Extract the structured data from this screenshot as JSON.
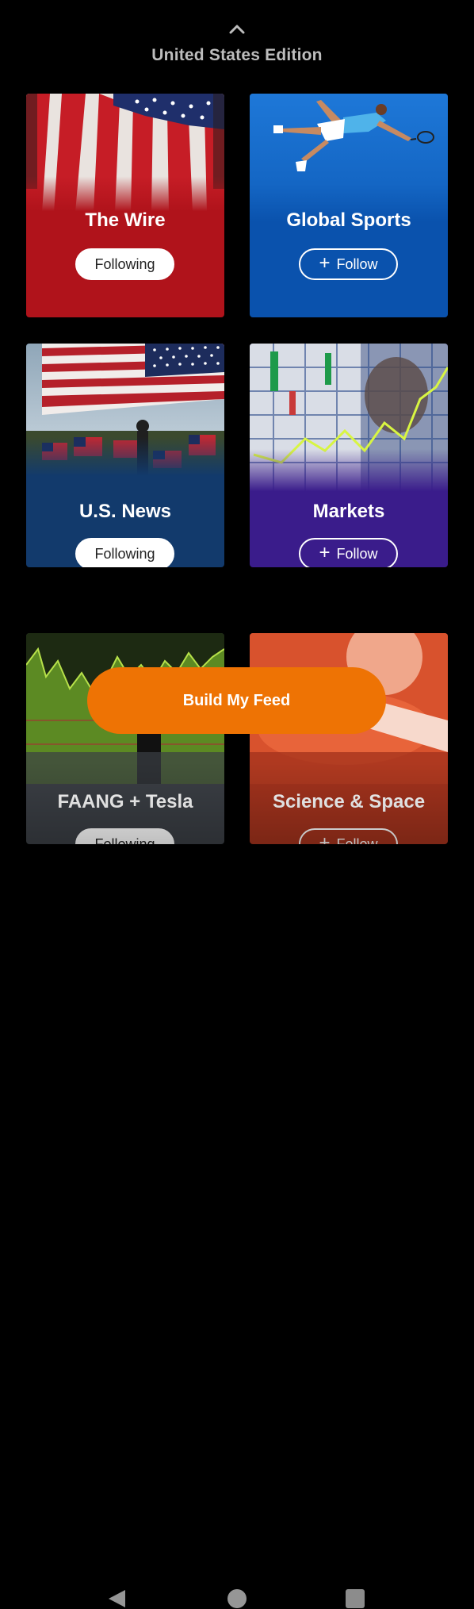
{
  "header": {
    "edition": "United States Edition"
  },
  "cards": [
    {
      "title": "The Wire",
      "button": "Following",
      "state": "following",
      "color": "#b0131b"
    },
    {
      "title": "Global Sports",
      "button": "Follow",
      "state": "follow",
      "color": "#0a52ad"
    },
    {
      "title": "U.S. News",
      "button": "Following",
      "state": "following",
      "color": "#123a6c"
    },
    {
      "title": "Markets",
      "button": "Follow",
      "state": "follow",
      "color": "#3a1c8b"
    },
    {
      "title": "FAANG + Tesla",
      "button": "Following",
      "state": "following",
      "color": "#3b3f45"
    },
    {
      "title": "Science & Space",
      "button": "Follow",
      "state": "follow",
      "color": "#a5331d"
    }
  ],
  "cta": {
    "label": "Build My Feed",
    "color": "#ee7304"
  },
  "icons": {
    "collapse": "chevron-up-icon",
    "follow": "plus-icon",
    "nav_back": "back-triangle-icon",
    "nav_home": "home-circle-icon",
    "nav_recents": "recents-square-icon"
  }
}
